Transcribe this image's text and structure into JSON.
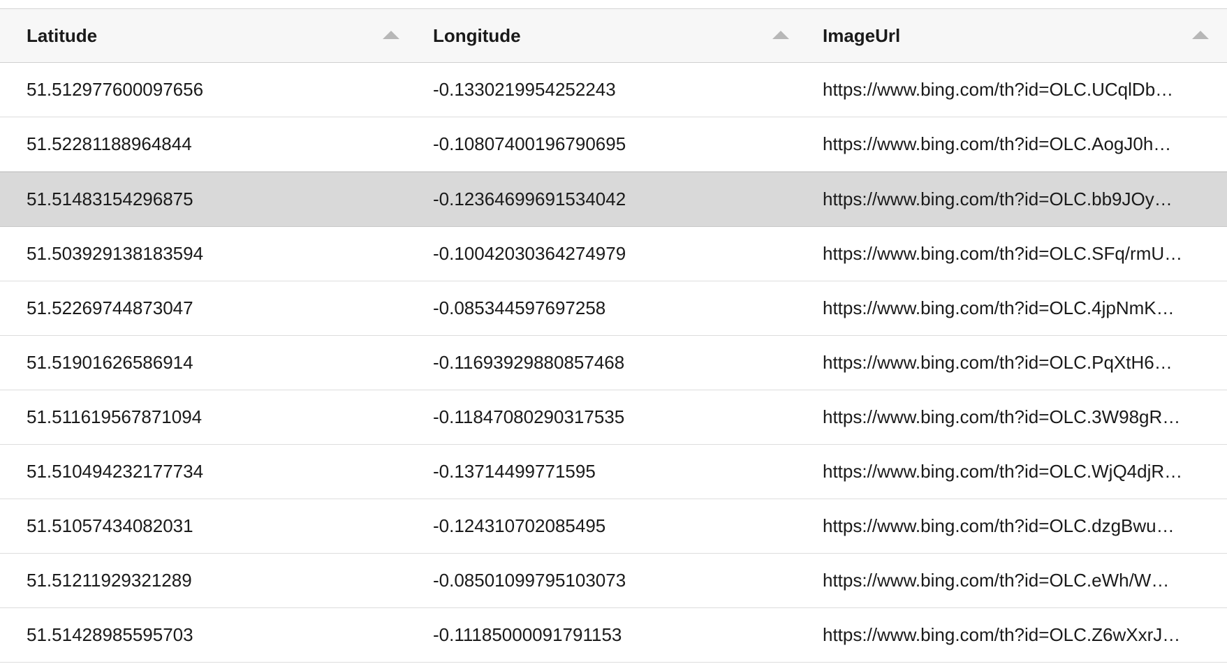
{
  "table": {
    "columns": [
      {
        "label": "Latitude",
        "sort_icon": "sort-ascending-icon"
      },
      {
        "label": "Longitude",
        "sort_icon": "sort-ascending-icon"
      },
      {
        "label": "ImageUrl",
        "sort_icon": "sort-ascending-icon"
      }
    ],
    "selected_row_index": 2,
    "rows": [
      {
        "latitude": "51.512977600097656",
        "longitude": "-0.1330219954252243",
        "image_url": "https://www.bing.com/th?id=OLC.UCqlDb…"
      },
      {
        "latitude": "51.52281188964844",
        "longitude": "-0.10807400196790695",
        "image_url": "https://www.bing.com/th?id=OLC.AogJ0h…"
      },
      {
        "latitude": "51.51483154296875",
        "longitude": "-0.12364699691534042",
        "image_url": "https://www.bing.com/th?id=OLC.bb9JOy…"
      },
      {
        "latitude": "51.503929138183594",
        "longitude": "-0.10042030364274979",
        "image_url": "https://www.bing.com/th?id=OLC.SFq/rmU…"
      },
      {
        "latitude": "51.52269744873047",
        "longitude": "-0.085344597697258",
        "image_url": "https://www.bing.com/th?id=OLC.4jpNmK…"
      },
      {
        "latitude": "51.51901626586914",
        "longitude": "-0.11693929880857468",
        "image_url": "https://www.bing.com/th?id=OLC.PqXtH6…"
      },
      {
        "latitude": "51.511619567871094",
        "longitude": "-0.11847080290317535",
        "image_url": "https://www.bing.com/th?id=OLC.3W98gR…"
      },
      {
        "latitude": "51.510494232177734",
        "longitude": "-0.13714499771595",
        "image_url": "https://www.bing.com/th?id=OLC.WjQ4djR…"
      },
      {
        "latitude": "51.51057434082031",
        "longitude": "-0.124310702085495",
        "image_url": "https://www.bing.com/th?id=OLC.dzgBwu…"
      },
      {
        "latitude": "51.51211929321289",
        "longitude": "-0.08501099795103073",
        "image_url": "https://www.bing.com/th?id=OLC.eWh/W…"
      },
      {
        "latitude": "51.51428985595703",
        "longitude": "-0.11185000091791153",
        "image_url": "https://www.bing.com/th?id=OLC.Z6wXxrJ…"
      }
    ]
  }
}
